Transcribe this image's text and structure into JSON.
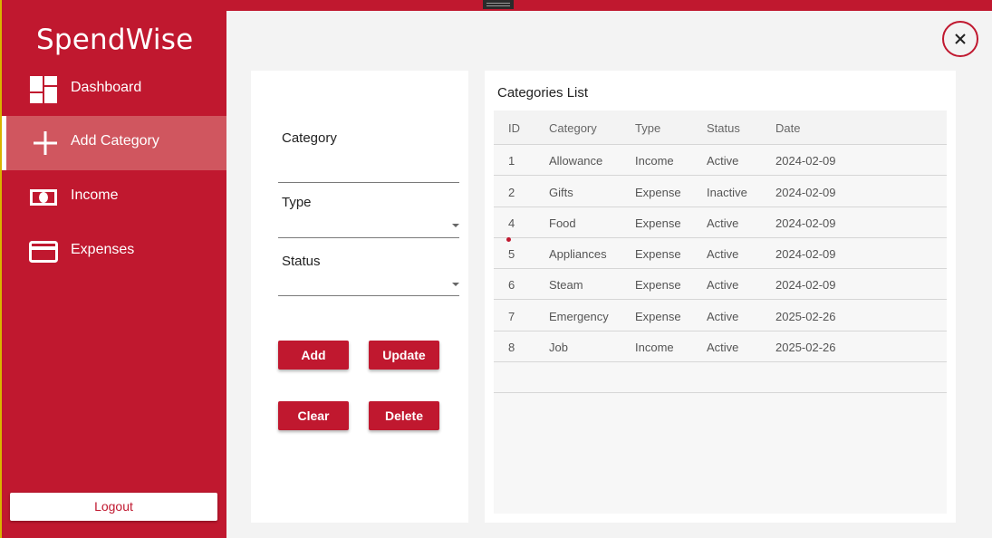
{
  "app": {
    "title": "SpendWise"
  },
  "sidebar": {
    "items": [
      {
        "label": "Dashboard",
        "icon": "dashboard-icon",
        "active": false
      },
      {
        "label": "Add Category",
        "icon": "plus-icon",
        "active": true
      },
      {
        "label": "Income",
        "icon": "money-icon",
        "active": false
      },
      {
        "label": "Expenses",
        "icon": "credit-card-icon",
        "active": false
      }
    ],
    "logout_label": "Logout"
  },
  "form": {
    "category_label": "Category",
    "category_value": "",
    "type_label": "Type",
    "type_value": "",
    "status_label": "Status",
    "status_value": "",
    "buttons": {
      "add": "Add",
      "update": "Update",
      "clear": "Clear",
      "delete": "Delete"
    }
  },
  "list": {
    "title": "Categories List",
    "columns": [
      "ID",
      "Category",
      "Type",
      "Status",
      "Date"
    ],
    "rows": [
      [
        "1",
        "Allowance",
        "Income",
        "Active",
        "2024-02-09"
      ],
      [
        "2",
        "Gifts",
        "Expense",
        "Inactive",
        "2024-02-09"
      ],
      [
        "4",
        "Food",
        "Expense",
        "Active",
        "2024-02-09"
      ],
      [
        "5",
        "Appliances",
        "Expense",
        "Active",
        "2024-02-09"
      ],
      [
        "6",
        "Steam",
        "Expense",
        "Active",
        "2024-02-09"
      ],
      [
        "7",
        "Emergency",
        "Expense",
        "Active",
        "2025-02-26"
      ],
      [
        "8",
        "Job",
        "Income",
        "Active",
        "2025-02-26"
      ]
    ]
  },
  "colors": {
    "accent": "#c0182f",
    "active_nav": "#d0565f",
    "background": "#f3f3f3"
  }
}
